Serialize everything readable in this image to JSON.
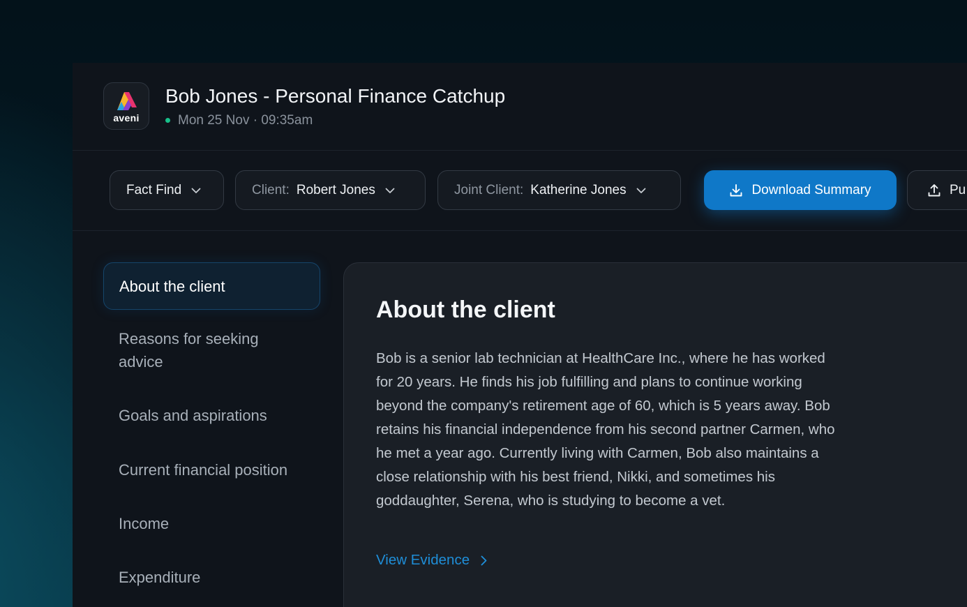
{
  "app": {
    "logo_text": "aveni",
    "title": "Bob Jones - Personal Finance Catchup",
    "meeting_time": "Mon 25 Nov · 09:35am",
    "status_color": "#18c08a"
  },
  "toolbar": {
    "fact_find": "Fact Find",
    "client_label": "Client:",
    "client_value": "Robert Jones",
    "joint_client_label": "Joint Client:",
    "joint_client_value": "Katherine Jones",
    "download_label": "Download Summary",
    "publish_label_partial": "Pu",
    "accent_color": "#0f78c8"
  },
  "sidebar": {
    "items": [
      {
        "label": "About the client",
        "active": true
      },
      {
        "label": "Reasons for seeking advice",
        "active": false
      },
      {
        "label": "Goals and aspirations",
        "active": false
      },
      {
        "label": "Current financial position",
        "active": false
      },
      {
        "label": "Income",
        "active": false
      },
      {
        "label": "Expenditure",
        "active": false
      }
    ]
  },
  "section": {
    "title": "About the client",
    "body": "Bob is a senior lab technician at HealthCare Inc., where he has worked for 20 years. He finds his job fulfilling and plans to continue working beyond the company's retirement age of 60, which is 5 years away. Bob retains his financial independence from his second partner Carmen, who he met a year ago. Currently living with Carmen, Bob also maintains a close relationship with his best friend, Nikki, and sometimes his goddaughter, Serena, who is studying to become a vet.",
    "evidence_link": "View Evidence"
  }
}
